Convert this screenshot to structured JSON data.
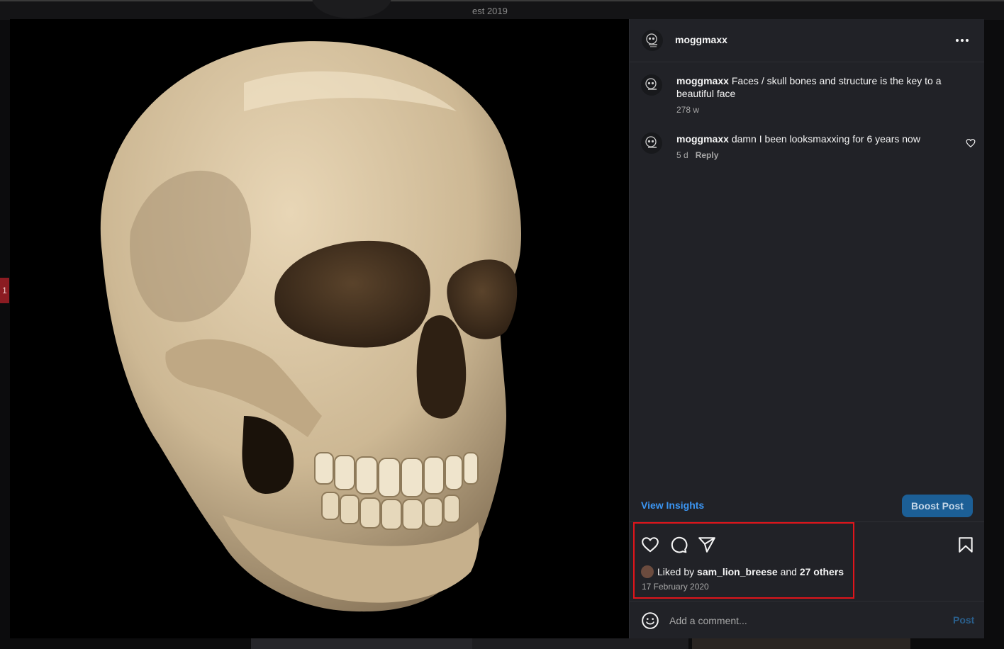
{
  "background": {
    "profile_est_text": "est 2019",
    "side_tab_number": "1"
  },
  "post": {
    "image_subject": "human skull photograph",
    "author": {
      "username": "moggmaxx"
    },
    "more_icon": "more-horizontal-icon",
    "comments": [
      {
        "username": "moggmaxx",
        "text": "Faces / skull bones and structure is the key to a beautiful face",
        "age": "278 w"
      },
      {
        "username": "moggmaxx",
        "text": "damn I been looksmaxxing for 6 years now",
        "age": "5 d",
        "reply_label": "Reply"
      }
    ],
    "insights_label": "View Insights",
    "boost_label": "Boost Post",
    "action_icons": [
      "heart-icon",
      "comment-icon",
      "share-icon",
      "bookmark-icon"
    ],
    "likes": {
      "prefix": "Liked by",
      "user": "sam_lion_breese",
      "middle": "and",
      "others": "27 others"
    },
    "date": "17 February 2020",
    "add_comment_placeholder": "Add a comment...",
    "post_label": "Post"
  },
  "colors": {
    "panel_bg": "#212227",
    "accent_link": "#3b95f2",
    "boost_button": "#1c5f96",
    "highlight_box": "#e0151b"
  }
}
